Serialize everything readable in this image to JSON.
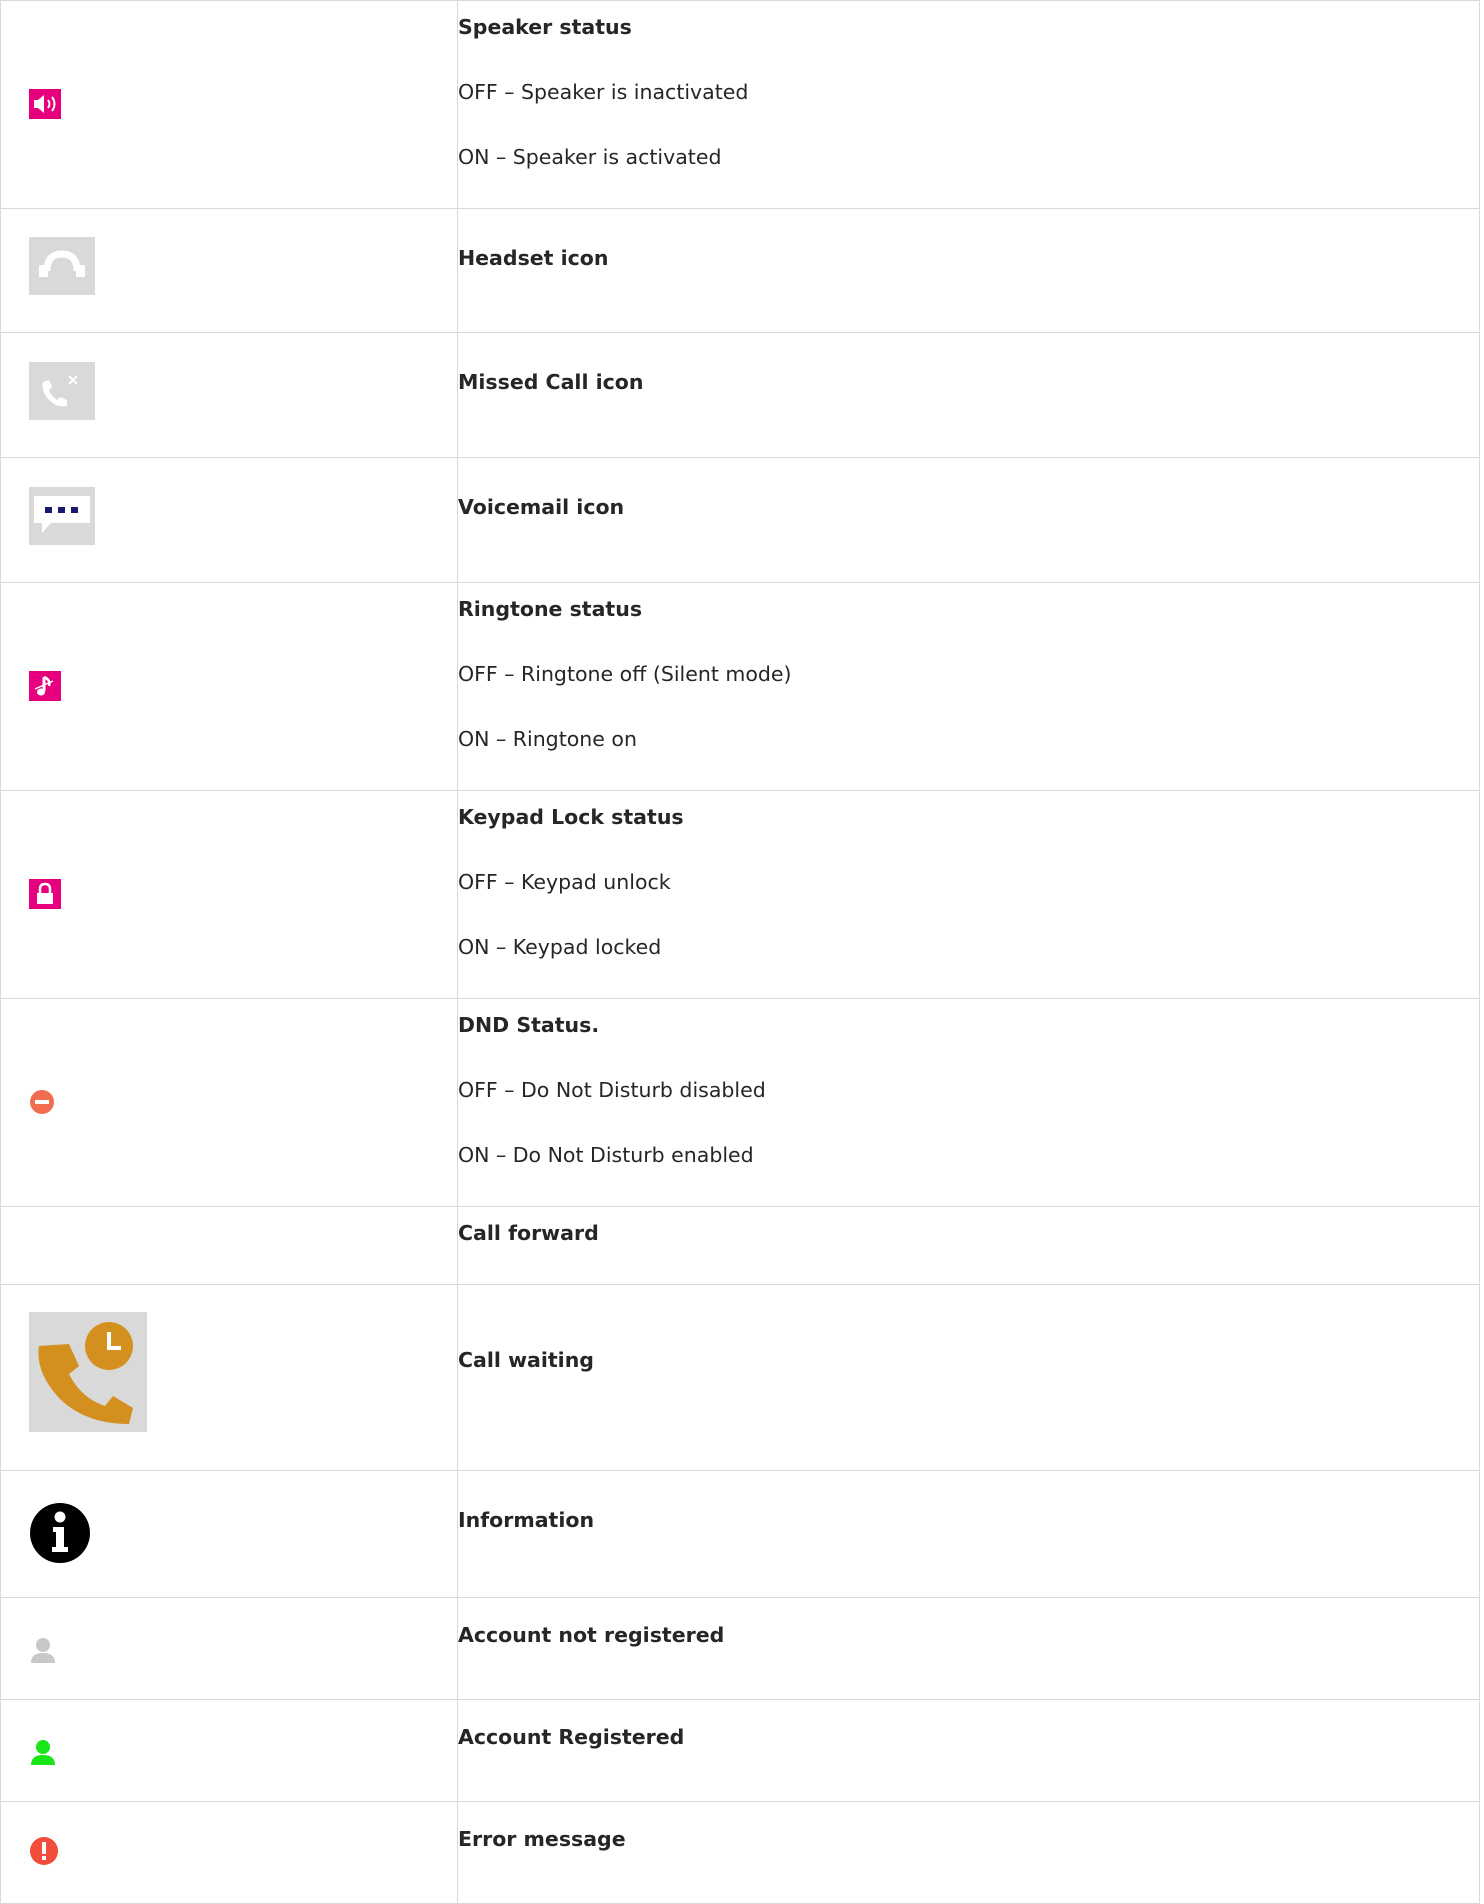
{
  "rows": [
    {
      "title": "Speaker status",
      "lines": [
        "OFF – Speaker is inactivated",
        "ON – Speaker is activated"
      ],
      "icon": "speaker-icon",
      "color": "#e6007e"
    },
    {
      "title": "Headset icon",
      "lines": [],
      "icon": "headset-icon",
      "color": "#d9d9d9"
    },
    {
      "title": "Missed Call icon",
      "lines": [],
      "icon": "missed-call-icon",
      "color": "#d9d9d9"
    },
    {
      "title": "Voicemail icon",
      "lines": [],
      "icon": "voicemail-icon",
      "color": "#d9d9d9"
    },
    {
      "title": "Ringtone status",
      "lines": [
        "OFF – Ringtone off (Silent mode)",
        "ON – Ringtone on"
      ],
      "icon": "ringtone-icon",
      "color": "#e6007e"
    },
    {
      "title": "Keypad Lock status",
      "lines": [
        "OFF – Keypad unlock",
        "ON – Keypad locked"
      ],
      "icon": "lock-icon",
      "color": "#e6007e"
    },
    {
      "title": "DND Status.",
      "lines": [
        "OFF – Do Not Disturb disabled",
        "ON – Do Not Disturb enabled"
      ],
      "icon": "dnd-icon",
      "color": "#f26c4f"
    },
    {
      "title": "Call forward",
      "lines": [],
      "icon": "",
      "color": ""
    },
    {
      "title": "Call waiting",
      "lines": [],
      "icon": "call-waiting-icon",
      "color": "#d4901f"
    },
    {
      "title": "Information",
      "lines": [],
      "icon": "info-icon",
      "color": "#000000"
    },
    {
      "title": "Account not registered",
      "lines": [],
      "icon": "account-unregistered-icon",
      "color": "#c8c8c8"
    },
    {
      "title": "Account Registered",
      "lines": [],
      "icon": "account-registered-icon",
      "color": "#19e619"
    },
    {
      "title": "Error message",
      "lines": [],
      "icon": "error-icon",
      "color": "#f24d3a"
    }
  ]
}
